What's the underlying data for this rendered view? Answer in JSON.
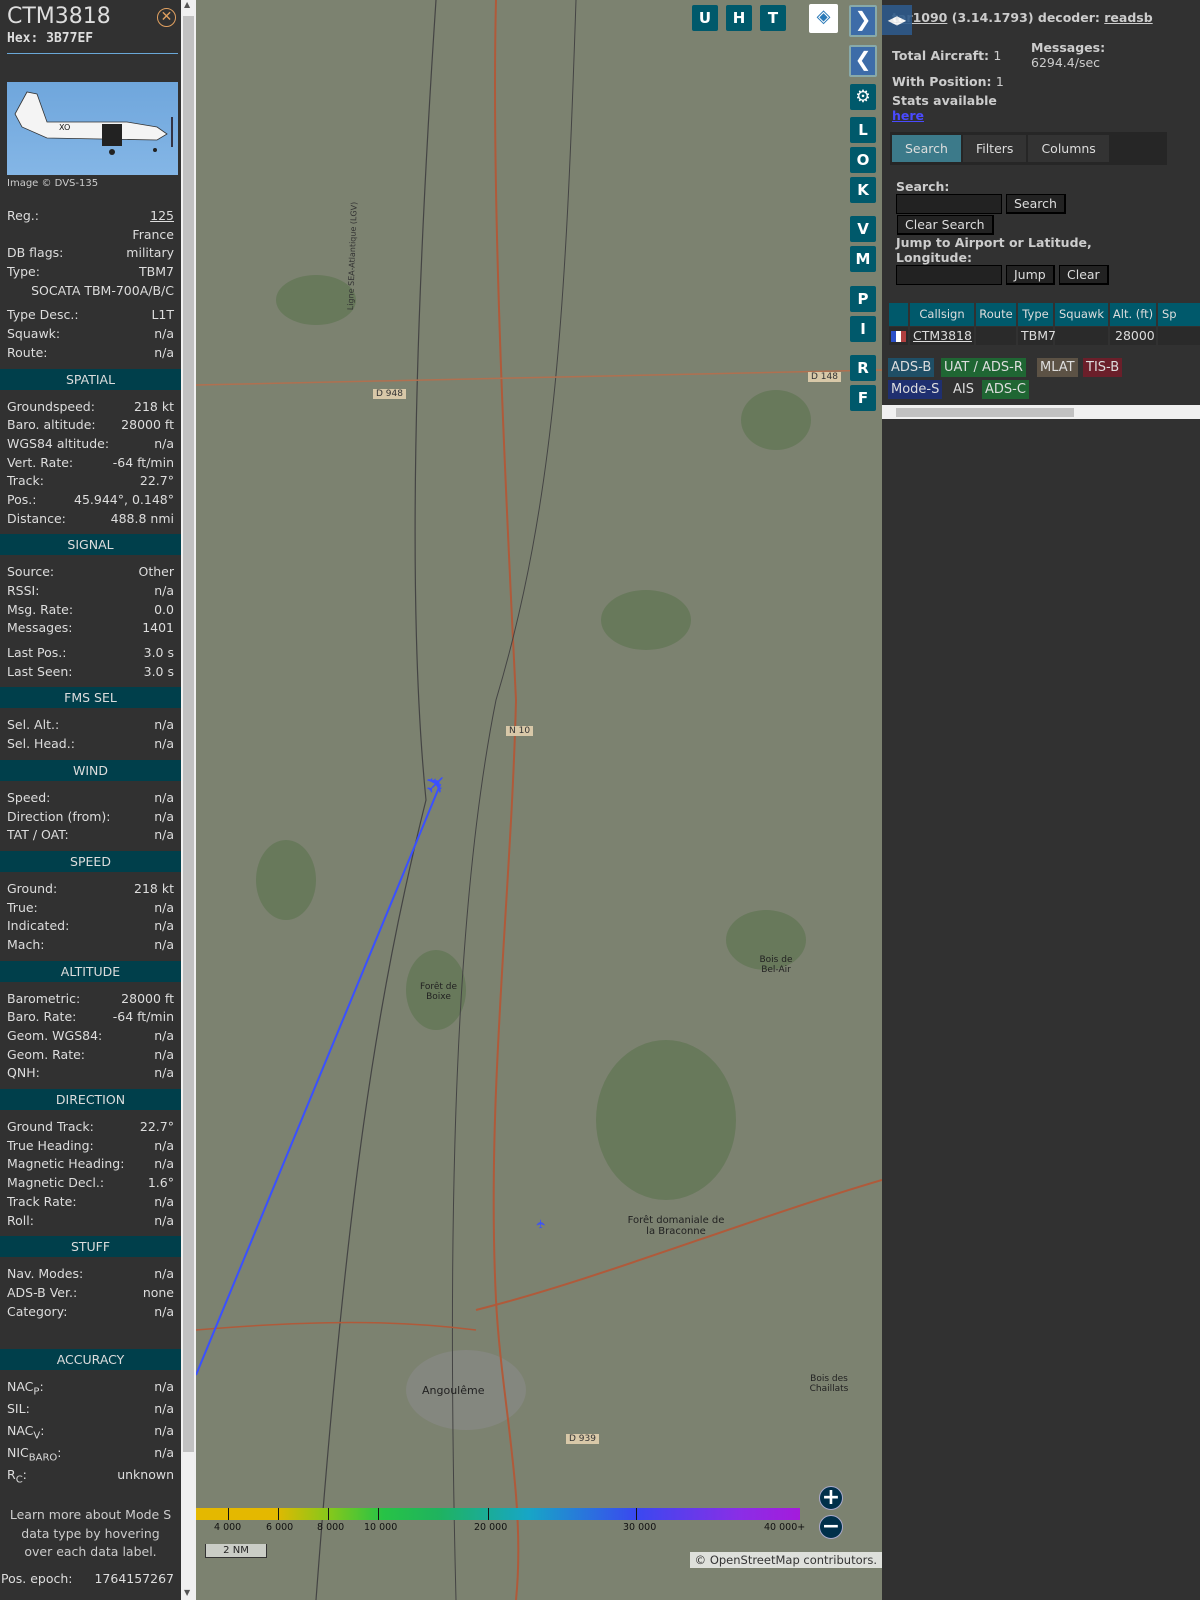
{
  "aircraft": {
    "callsign": "CTM3818",
    "hex_label": "Hex:",
    "hex": "3B77EF",
    "close_icon": "close-icon",
    "image_credit": "Image © DVS-135"
  },
  "info": [
    {
      "l": "Reg.:",
      "v": "125",
      "link": true
    },
    {
      "l": "",
      "v": "France"
    },
    {
      "l": "DB flags:",
      "v": "military"
    },
    {
      "l": "Type:",
      "v": "TBM7"
    },
    {
      "l": "",
      "v": "SOCATA TBM-700A/B/C"
    },
    {
      "l": "Type Desc.:",
      "v": "L1T"
    },
    {
      "l": "Squawk:",
      "v": "n/a"
    },
    {
      "l": "Route:",
      "v": "n/a"
    }
  ],
  "sections": [
    {
      "title": "SPATIAL",
      "rows": [
        {
          "l": "Groundspeed:",
          "v": "218 kt"
        },
        {
          "l": "Baro. altitude:",
          "v": "28000 ft"
        },
        {
          "l": "WGS84 altitude:",
          "v": "n/a"
        },
        {
          "l": "Vert. Rate:",
          "v": "-64 ft/min"
        },
        {
          "l": "Track:",
          "v": "22.7°"
        },
        {
          "l": "Pos.:",
          "v": "45.944°, 0.148°"
        },
        {
          "l": "Distance:",
          "v": "488.8 nmi"
        }
      ]
    },
    {
      "title": "SIGNAL",
      "rows": [
        {
          "l": "Source:",
          "v": "Other"
        },
        {
          "l": "RSSI:",
          "v": "n/a"
        },
        {
          "l": "Msg. Rate:",
          "v": "0.0"
        },
        {
          "l": "Messages:",
          "v": "1401"
        },
        {
          "l": "Last Pos.:",
          "v": "3.0 s"
        },
        {
          "l": "Last Seen:",
          "v": "3.0 s"
        }
      ]
    },
    {
      "title": "FMS SEL",
      "rows": [
        {
          "l": "Sel. Alt.:",
          "v": "n/a"
        },
        {
          "l": "Sel. Head.:",
          "v": "n/a"
        }
      ]
    },
    {
      "title": "WIND",
      "rows": [
        {
          "l": "Speed:",
          "v": "n/a"
        },
        {
          "l": "Direction (from):",
          "v": "n/a"
        },
        {
          "l": "TAT / OAT:",
          "v": "n/a"
        }
      ]
    },
    {
      "title": "SPEED",
      "rows": [
        {
          "l": "Ground:",
          "v": "218 kt"
        },
        {
          "l": "True:",
          "v": "n/a"
        },
        {
          "l": "Indicated:",
          "v": "n/a"
        },
        {
          "l": "Mach:",
          "v": "n/a"
        }
      ]
    },
    {
      "title": "ALTITUDE",
      "rows": [
        {
          "l": "Barometric:",
          "v": "28000 ft"
        },
        {
          "l": "Baro. Rate:",
          "v": "-64 ft/min"
        },
        {
          "l": "Geom. WGS84:",
          "v": "n/a"
        },
        {
          "l": "Geom. Rate:",
          "v": "n/a"
        },
        {
          "l": "QNH:",
          "v": "n/a"
        }
      ]
    },
    {
      "title": "DIRECTION",
      "rows": [
        {
          "l": "Ground Track:",
          "v": "22.7°"
        },
        {
          "l": "True Heading:",
          "v": "n/a"
        },
        {
          "l": "Magnetic Heading:",
          "v": "n/a"
        },
        {
          "l": "Magnetic Decl.:",
          "v": "1.6°"
        },
        {
          "l": "Track Rate:",
          "v": "n/a"
        },
        {
          "l": "Roll:",
          "v": "n/a"
        }
      ]
    },
    {
      "title": "STUFF",
      "rows": [
        {
          "l": "Nav. Modes:",
          "v": "n/a"
        },
        {
          "l": "ADS-B Ver.:",
          "v": "none"
        },
        {
          "l": "Category:",
          "v": "n/a"
        }
      ]
    }
  ],
  "accuracy": {
    "title": "ACCURACY",
    "rows": [
      {
        "b": "NAC",
        "s": "P",
        "v": "n/a"
      },
      {
        "b": "SIL",
        "s": "",
        "v": "n/a"
      },
      {
        "b": "NAC",
        "s": "V",
        "v": "n/a"
      },
      {
        "b": "NIC",
        "s": "BARO",
        "v": "n/a"
      },
      {
        "b": "R",
        "s": "C",
        "v": "unknown"
      }
    ]
  },
  "learn_more": "Learn more about Mode S data type by hovering over each data label.",
  "pos_epoch": {
    "l": "Pos. epoch:",
    "v": "1764157267"
  },
  "map": {
    "top_buttons": [
      "U",
      "H",
      "T"
    ],
    "side_buttons": [
      "L",
      "O",
      "K",
      "V",
      "M",
      "P",
      "I",
      "R",
      "F"
    ],
    "legend_labels": [
      "4 000",
      "6 000",
      "8 000",
      "10 000",
      "20 000",
      "30 000",
      "40 000+"
    ],
    "scale": "2 NM",
    "attribution_prefix": "© ",
    "attribution_link": "OpenStreetMap",
    "attribution_suffix": " contributors.",
    "labels": [
      "D 948",
      "N 10",
      "D 148",
      "D 939",
      "Angoulême",
      "Forêt de Boixe",
      "Forêt domaniale de la Braconne",
      "Bois de Bel-Air",
      "Bois des Chaillats",
      "Ligne SEA-Atlantique (LGV)"
    ]
  },
  "right": {
    "app": "tar1090",
    "version": " (3.14.1793) decoder: ",
    "decoder": "readsb",
    "total_label": "Total Aircraft: ",
    "total": "1",
    "pos_label": "With Position: ",
    "pos": "1",
    "msg_label": "Messages:",
    "msg": "6294.4/sec",
    "stats": "Stats available",
    "here": "here",
    "tabs": [
      "Search",
      "Filters",
      "Columns"
    ],
    "search_label": "Search:",
    "search_btn": "Search",
    "clear_search": "Clear Search",
    "jump_label": "Jump to Airport or Latitude, Longitude:",
    "jump_btn": "Jump",
    "clear_btn": "Clear",
    "columns": [
      "Callsign",
      "Route",
      "Type",
      "Squawk",
      "Alt. (ft)",
      "Sp"
    ],
    "row": {
      "callsign": "CTM3818",
      "route": "",
      "type": "TBM7",
      "squawk": "",
      "alt": "28000"
    },
    "badges": [
      {
        "t": "ADS-B",
        "c": "#1f4f66"
      },
      {
        "t": "UAT / ADS-R",
        "c": "#1f6633"
      },
      {
        "t": "MLAT",
        "c": "#5c5245"
      },
      {
        "t": "TIS-B",
        "c": "#6b1f2a"
      },
      {
        "t": "Mode-S",
        "c": "#1f2f70"
      },
      {
        "t": "AIS",
        "c": "#313131"
      },
      {
        "t": "ADS-C",
        "c": "#1f6633"
      }
    ]
  }
}
